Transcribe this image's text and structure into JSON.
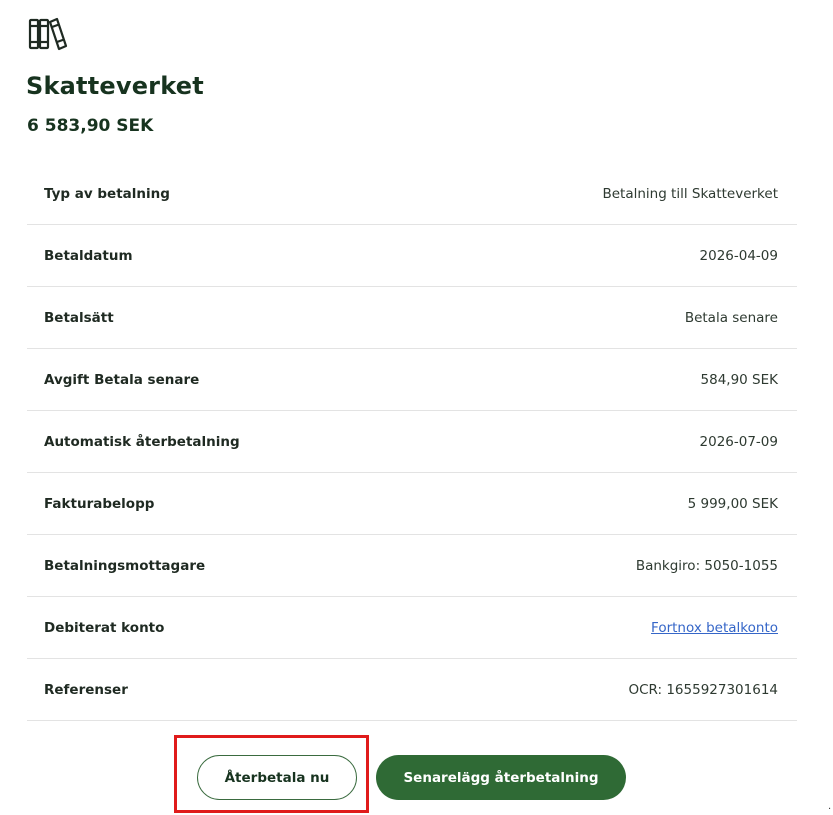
{
  "header": {
    "icon": "books-icon",
    "title": "Skatteverket",
    "amount": "6 583,90 SEK"
  },
  "details": [
    {
      "label": "Typ av betalning",
      "value": "Betalning till Skatteverket"
    },
    {
      "label": "Betaldatum",
      "value": "2026-04-09"
    },
    {
      "label": "Betalsätt",
      "value": "Betala senare"
    },
    {
      "label": "Avgift Betala senare",
      "value": "584,90 SEK"
    },
    {
      "label": "Automatisk återbetalning",
      "value": "2026-07-09"
    },
    {
      "label": "Fakturabelopp",
      "value": "5 999,00 SEK"
    },
    {
      "label": "Betalningsmottagare",
      "value": "Bankgiro: 5050-1055"
    },
    {
      "label": "Debiterat konto",
      "value": "Fortnox betalkonto"
    },
    {
      "label": "Referenser",
      "value": "OCR: 1655927301614"
    }
  ],
  "actions": {
    "repay_now_label": "Återbetala nu",
    "postpone_label": "Senarelägg återbetalning"
  },
  "colors": {
    "primary_green": "#2f6a35",
    "title_green": "#17331f",
    "link_blue": "#3566c8",
    "highlight_red": "#e01b1b"
  },
  "footer": {
    "dot": "."
  }
}
